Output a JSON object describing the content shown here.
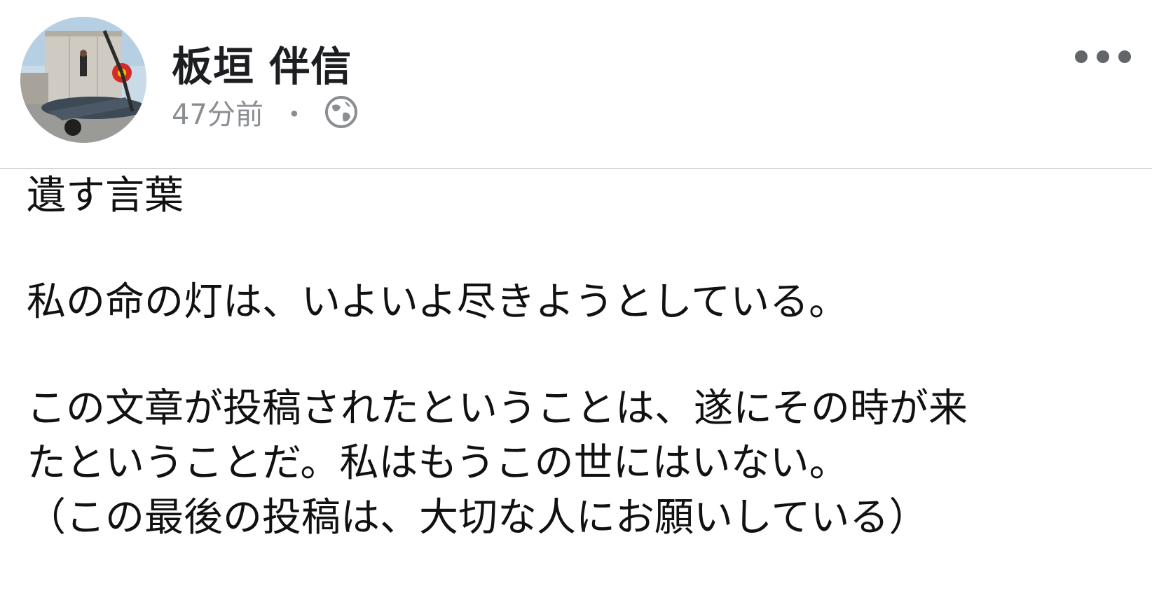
{
  "author": {
    "name": "板垣 伴信",
    "avatar_icon": "profile-photo-airplane"
  },
  "meta": {
    "time": "47分前",
    "separator": "・",
    "privacy_icon": "globe-icon"
  },
  "menu": {
    "more_icon": "more-options-icon"
  },
  "post": {
    "title": "遺す言葉",
    "lines": [
      "私の命の灯は、いよいよ尽きようとしている。",
      "この文章が投稿されたということは、遂にその時が来",
      "たということだ。私はもうこの世にはいない。",
      "（この最後の投稿は、大切な人にお願いしている）"
    ]
  },
  "colors": {
    "text": "#111111",
    "meta": "#8a8d91",
    "divider": "#cfcfcf"
  }
}
